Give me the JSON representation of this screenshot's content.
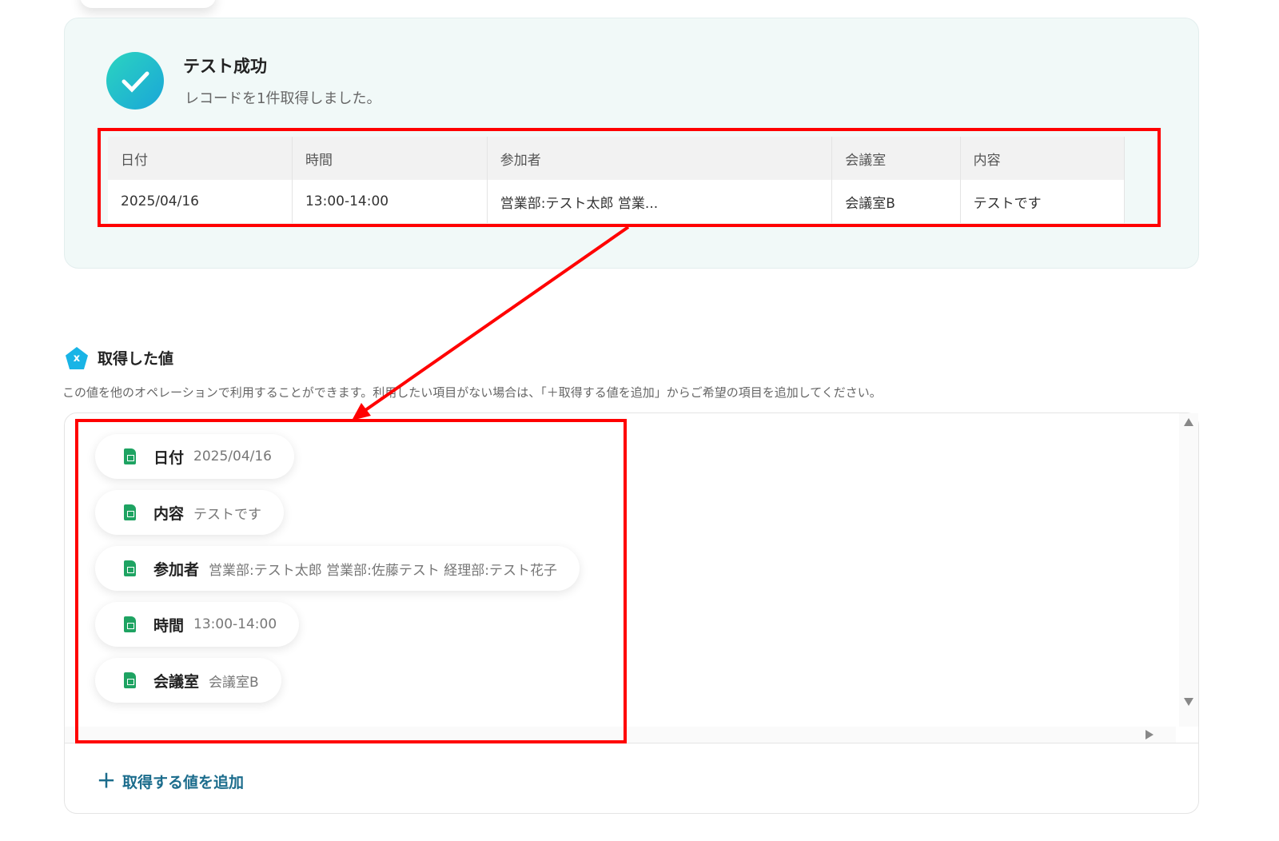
{
  "result": {
    "title": "テスト成功",
    "message": "レコードを1件取得しました。"
  },
  "table": {
    "headers": [
      "日付",
      "時間",
      "参加者",
      "会議室",
      "内容"
    ],
    "row": [
      "2025/04/16",
      "13:00-14:00",
      "営業部:テスト太郎 営業...",
      "会議室B",
      "テストです"
    ]
  },
  "values_section": {
    "title": "取得した値",
    "icon_label": "x",
    "description": "この値を他のオペレーションで利用することができます。利用したい項目がない場合は、「＋取得する値を追加」からご希望の項目を追加してください。",
    "items": [
      {
        "key": "日付",
        "value": "2025/04/16"
      },
      {
        "key": "内容",
        "value": "テストです"
      },
      {
        "key": "参加者",
        "value": "営業部:テスト太郎 営業部:佐藤テスト 経理部:テスト花子"
      },
      {
        "key": "時間",
        "value": "13:00-14:00"
      },
      {
        "key": "会議室",
        "value": "会議室B"
      }
    ],
    "add_label": "取得する値を追加"
  },
  "colors": {
    "annotation": "#ff0000",
    "accent": "#1b6c8c"
  }
}
